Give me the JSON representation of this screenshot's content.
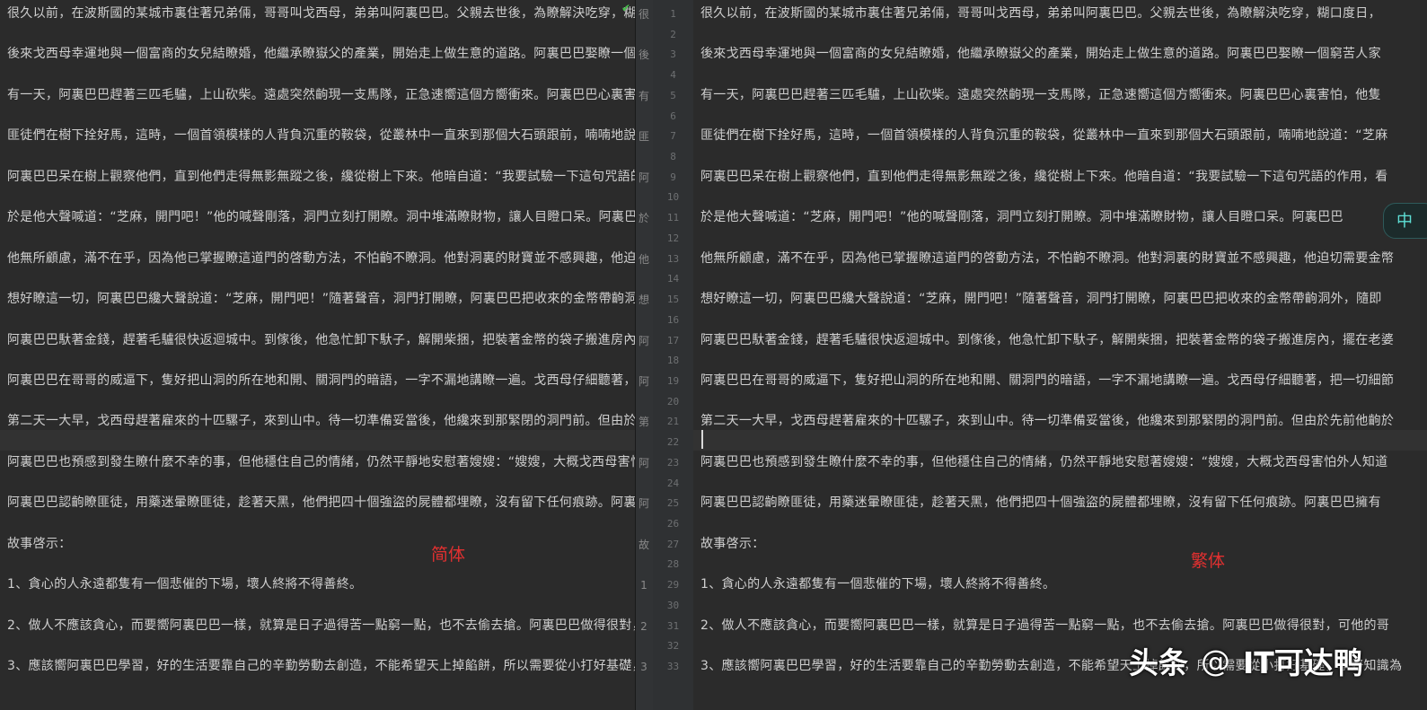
{
  "lines": [
    "很久以前，在波斯國的某城市裏住著兄弟倆，哥哥叫戈西母，弟弟叫阿裏巴巴。父親去世後，為瞭解決吃穿，糊口度日，",
    "",
    "後來戈西母幸運地與一個富商的女兒結瞭婚，他繼承瞭嶽父的產業，開始走上做生意的道路。阿裏巴巴娶瞭一個窮苦人家",
    "",
    "有一天，阿裏巴巴趕著三匹毛驢，上山砍柴。遠處突然齣現一支馬隊，正急速嚮這個方嚮衝來。阿裏巴巴心裏害怕，他隻",
    "",
    "匪徒們在樹下拴好馬，這時，一個首領模樣的人背負沉重的鞍袋，從叢林中一直來到那個大石頭跟前，喃喃地說道：“芝麻",
    "",
    "阿裏巴巴呆在樹上觀察他們，直到他們走得無影無蹤之後，纔從樹上下來。他暗自道：“我要試驗一下這句咒語的作用，看",
    "",
    "於是他大聲喊道：“芝麻，開門吧！”他的喊聲剛落，洞門立刻打開瞭。洞中堆滿瞭財物，讓人目瞪口呆。阿裏巴巴",
    "",
    "他無所顧慮，滿不在乎，因為他已掌握瞭這道門的啓動方法，不怕齣不瞭洞。他對洞裏的財寶並不感興趣，他迫切需要金幣",
    "",
    "想好瞭這一切，阿裏巴巴纔大聲說道：“芝麻，開門吧！”隨著聲音，洞門打開瞭，阿裏巴巴把收來的金幣帶齣洞外，隨即",
    "",
    "阿裏巴巴馱著金錢，趕著毛驢很快返迴城中。到傢後，他急忙卸下馱子，解開柴捆，把裝著金幣的袋子搬進房內，擺在老婆",
    "",
    "阿裏巴巴在哥哥的威逼下，隻好把山洞的所在地和開、關洞門的暗語，一字不漏地講瞭一遍。戈西母仔細聽著，把一切細節",
    "",
    "第二天一大早，戈西母趕著雇來的十匹騾子，來到山中。待一切準備妥當後，他纔來到那緊閉的洞門前。但由於先前他齣於",
    "",
    "阿裏巴巴也預感到發生瞭什麼不幸的事，但他穩住自己的情緒，仍然平靜地安慰著嫂嫂：“嫂嫂，大概戈西母害怕外人知道",
    "",
    "阿裏巴巴認齣瞭匪徒，用藥迷暈瞭匪徒，趁著天黑，他們把四十個強盜的屍體都埋瞭，沒有留下任何痕跡。阿裏巴巴擁有",
    "",
    "故事啓示：",
    "",
    "1、貪心的人永遠都隻有一個悲催的下場，壞人終將不得善終。",
    "",
    "2、做人不應該貪心，而要嚮阿裏巴巴一樣，就算是日子過得苦一點窮一點，也不去偷去搶。阿裏巴巴做得很對，可他的哥",
    "",
    "3、應該嚮阿裏巴巴學習，好的生活要靠自己的辛勤勞動去創造，不能希望天上掉餡餅，所以需要從小打好基礎，學好知識為"
  ],
  "line_numbers": [
    "1",
    "2",
    "3",
    "4",
    "5",
    "6",
    "7",
    "8",
    "9",
    "10",
    "11",
    "12",
    "13",
    "14",
    "15",
    "16",
    "17",
    "18",
    "19",
    "20",
    "21",
    "22",
    "23",
    "24",
    "25",
    "26",
    "27",
    "28",
    "29",
    "30",
    "31",
    "32",
    "33"
  ],
  "gutter_chars": [
    "很",
    "",
    "後",
    "",
    "有",
    "",
    "匪",
    "",
    "阿",
    "",
    "於",
    "",
    "他",
    "",
    "想",
    "",
    "阿",
    "",
    "阿",
    "",
    "第",
    "",
    "阿",
    "",
    "阿",
    "",
    "故",
    "",
    "1",
    "",
    "2",
    "",
    "3"
  ],
  "left_label": "简体",
  "right_label": "繁体",
  "ime_indicator": "中",
  "watermark": {
    "brand": "头条",
    "at": "@",
    "handle": "IT可达鸭"
  },
  "colors": {
    "label": "#e03030",
    "editor_bg": "#2b2b2b",
    "text": "#cfcfcf"
  },
  "icons": [
    "check-icon"
  ]
}
